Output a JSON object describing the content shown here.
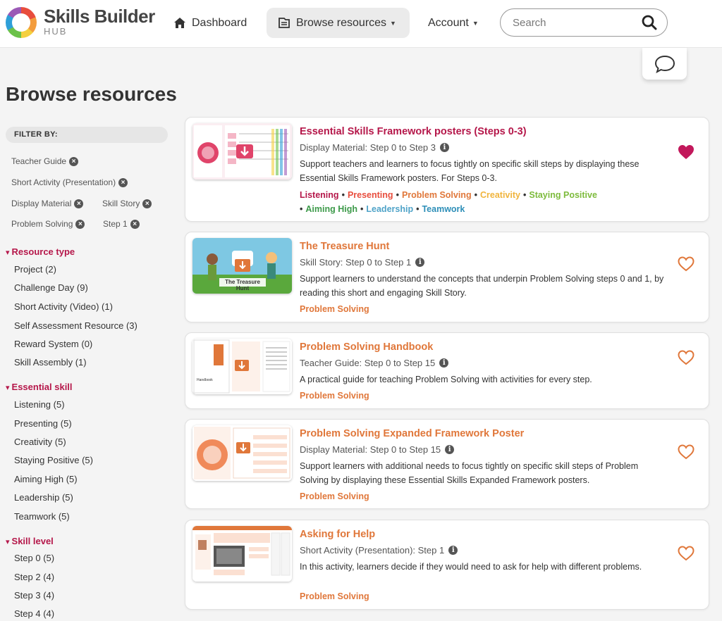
{
  "header": {
    "brand_name": "Skills Builder",
    "brand_sub": "HUB",
    "nav": {
      "dashboard": "Dashboard",
      "browse": "Browse resources",
      "account": "Account"
    },
    "search_placeholder": "Search"
  },
  "page_title": "Browse resources",
  "filters": {
    "heading": "FILTER BY:",
    "active": [
      "Teacher Guide",
      "Short Activity (Presentation)",
      "Display Material",
      "Skill Story",
      "Problem Solving",
      "Step 1"
    ],
    "sections": [
      {
        "title": "Resource type",
        "items": [
          "Project (2)",
          "Challenge Day (9)",
          "Short Activity (Video) (1)",
          "Self Assessment Resource (3)",
          "Reward System (0)",
          "Skill Assembly (1)"
        ]
      },
      {
        "title": "Essential skill",
        "items": [
          "Listening (5)",
          "Presenting (5)",
          "Creativity (5)",
          "Staying Positive (5)",
          "Aiming High (5)",
          "Leadership (5)",
          "Teamwork (5)"
        ]
      },
      {
        "title": "Skill level",
        "items": [
          "Step 0 (5)",
          "Step 2 (4)",
          "Step 3 (4)",
          "Step 4 (4)"
        ]
      }
    ]
  },
  "resources": [
    {
      "title": "Essential Skills Framework posters (Steps 0-3)",
      "meta": "Display Material: Step 0 to Step 3",
      "desc": "Support teachers and learners to focus tightly on specific skill steps by displaying these Essential Skills Framework posters. For Steps 0-3.",
      "tags": [
        "Listening",
        "Presenting",
        "Problem Solving",
        "Creativity",
        "Staying Positive",
        "Aiming High",
        "Leadership",
        "Teamwork"
      ],
      "favourited": true
    },
    {
      "title": "The Treasure Hunt",
      "meta": "Skill Story: Step 0 to Step 1",
      "desc": "Support learners to understand the concepts that underpin Problem Solving steps 0 and 1, by reading this short and engaging Skill Story.",
      "tags": [
        "Problem Solving"
      ],
      "thumb_caption": "The Treasure Hunt",
      "favourited": false
    },
    {
      "title": "Problem Solving Handbook",
      "meta": "Teacher Guide: Step 0 to Step 15",
      "desc": "A practical guide for teaching Problem Solving with activities for every step.",
      "tags": [
        "Problem Solving"
      ],
      "favourited": false
    },
    {
      "title": "Problem Solving Expanded Framework Poster",
      "meta": "Display Material: Step 0 to Step 15",
      "desc": "Support learners with additional needs to focus tightly on specific skill steps of Problem Solving by displaying these Essential Skills Expanded Framework posters.",
      "tags": [
        "Problem Solving"
      ],
      "favourited": false
    },
    {
      "title": "Asking for Help",
      "meta": "Short Activity (Presentation): Step 1",
      "desc": "In this activity, learners decide if they would need to ask for help with different problems.",
      "tags": [
        "Problem Solving"
      ],
      "favourited": false
    }
  ],
  "colors": {
    "accent_orange": "#e0773a",
    "crimson": "#b5174a",
    "heart_filled": "#c2185b"
  }
}
